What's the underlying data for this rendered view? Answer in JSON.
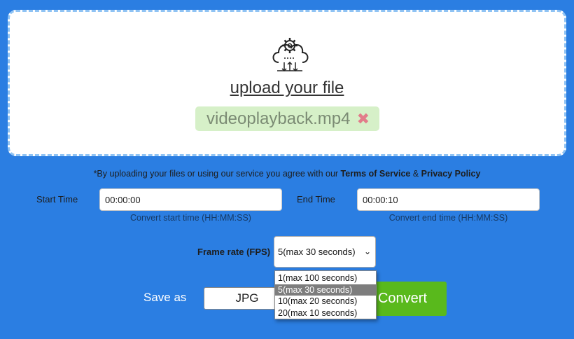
{
  "upload": {
    "link_label": "upload your file",
    "file_name": "videoplayback.mp4",
    "remove_glyph": "✖",
    "icon": "cloud-gear-transfer-icon"
  },
  "terms": {
    "prefix": "*By uploading your files or using our service you agree with our ",
    "tos": "Terms of Service",
    "amp": " & ",
    "privacy": "Privacy Policy"
  },
  "start": {
    "label": "Start Time",
    "value": "00:00:00",
    "hint": "Convert start time (HH:MM:SS)"
  },
  "end": {
    "label": "End Time",
    "value": "00:00:10",
    "hint": "Convert end time (HH:MM:SS)"
  },
  "fps": {
    "label": "Frame rate (FPS)",
    "selected": "5(max 30 seconds)",
    "options": [
      "1(max 100 seconds)",
      "5(max 30 seconds)",
      "10(max 20 seconds)",
      "20(max 10 seconds)"
    ],
    "selected_index": 1
  },
  "save": {
    "label": "Save as",
    "format": "JPG"
  },
  "convert": {
    "label": "Convert"
  },
  "colors": {
    "background": "#2b7ee2",
    "convert_button": "#59b91c",
    "file_chip": "#d6f0c8",
    "dropzone_border": "#8fc3f4"
  }
}
